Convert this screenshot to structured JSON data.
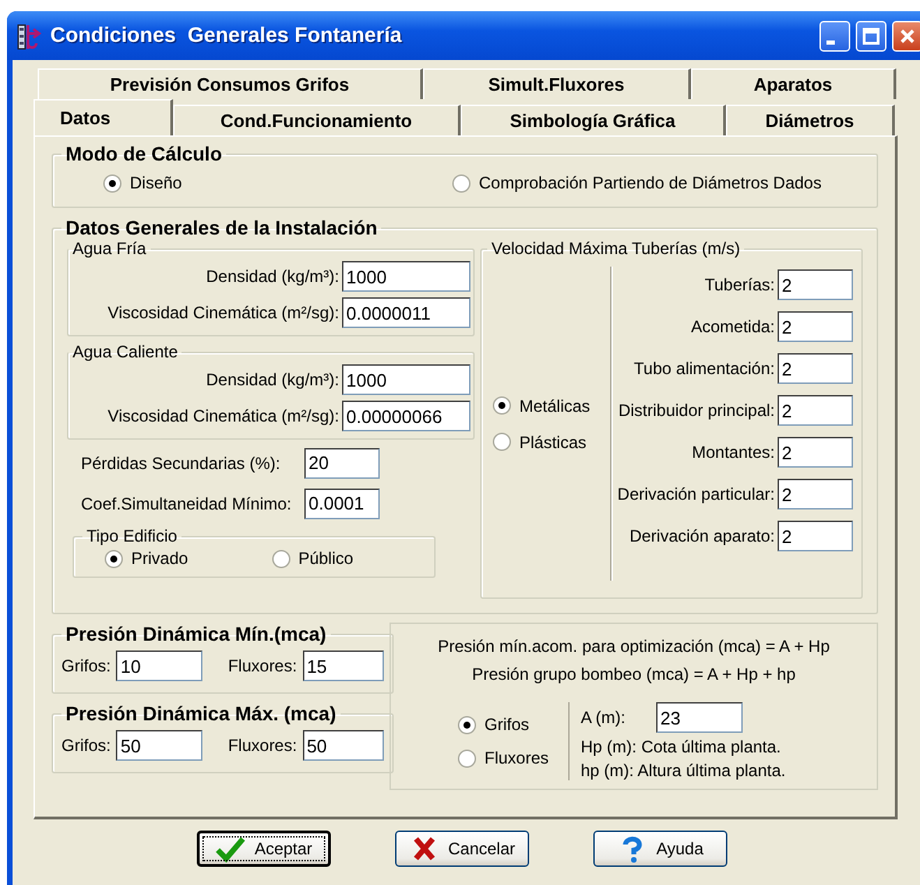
{
  "window": {
    "title": "Condiciones  Generales Fontanería"
  },
  "tab_rows": [
    {
      "tabs": [
        {
          "label": "Previsión Consumos Grifos",
          "selected": false
        },
        {
          "label": "Simult.Fluxores",
          "selected": false
        },
        {
          "label": "Aparatos",
          "selected": false
        }
      ]
    },
    {
      "tabs": [
        {
          "label": "Datos",
          "selected": true
        },
        {
          "label": "Cond.Funcionamiento",
          "selected": false
        },
        {
          "label": "Simbología Gráfica",
          "selected": false
        },
        {
          "label": "Diámetros",
          "selected": false
        }
      ]
    }
  ],
  "modo_calculo": {
    "title": "Modo de Cálculo",
    "options": [
      {
        "label": "Diseño",
        "selected": true
      },
      {
        "label": "Comprobación Partiendo de Diámetros Dados",
        "selected": false
      }
    ]
  },
  "datos_generales": {
    "title": "Datos Generales de la Instalación",
    "agua_fria": {
      "title": "Agua Fría",
      "fields": [
        {
          "label": "Densidad (kg/m³):",
          "value": "1000"
        },
        {
          "label": "Viscosidad Cinemática (m²/sg):",
          "value": "0.0000011"
        }
      ]
    },
    "agua_caliente": {
      "title": "Agua Caliente",
      "fields": [
        {
          "label": "Densidad (kg/m³):",
          "value": "1000"
        },
        {
          "label": "Viscosidad Cinemática (m²/sg):",
          "value": "0.00000066"
        }
      ]
    },
    "extra_fields": [
      {
        "label": "Pérdidas Secundarias (%):",
        "value": "20"
      },
      {
        "label": "Coef.Simultaneidad Mínimo:",
        "value": "0.0001"
      }
    ],
    "tipo_edificio": {
      "title": "Tipo Edificio",
      "options": [
        {
          "label": "Privado",
          "selected": true
        },
        {
          "label": "Público",
          "selected": false
        }
      ]
    },
    "velocidad": {
      "title": "Velocidad Máxima Tuberías (m/s)",
      "options": [
        {
          "label": "Metálicas",
          "selected": true
        },
        {
          "label": "Plásticas",
          "selected": false
        }
      ],
      "fields": [
        {
          "label": "Tuberías:",
          "value": "2"
        },
        {
          "label": "Acometida:",
          "value": "2"
        },
        {
          "label": "Tubo alimentación:",
          "value": "2"
        },
        {
          "label": "Distribuidor principal:",
          "value": "2"
        },
        {
          "label": "Montantes:",
          "value": "2"
        },
        {
          "label": "Derivación particular:",
          "value": "2"
        },
        {
          "label": "Derivación aparato:",
          "value": "2"
        }
      ]
    }
  },
  "presion_min": {
    "title": "Presión Dinámica Mín.(mca)",
    "fields": [
      {
        "label": "Grifos:",
        "value": "10"
      },
      {
        "label": "Fluxores:",
        "value": "15"
      }
    ]
  },
  "presion_max": {
    "title": "Presión Dinámica Máx. (mca)",
    "fields": [
      {
        "label": "Grifos:",
        "value": "50"
      },
      {
        "label": "Fluxores:",
        "value": "50"
      }
    ]
  },
  "optimizacion": {
    "formulas": [
      "Presión mín.acom. para optimización (mca) = A + Hp",
      "Presión grupo bombeo (mca) = A + Hp + hp"
    ],
    "options": [
      {
        "label": "Grifos",
        "selected": true
      },
      {
        "label": "Fluxores",
        "selected": false
      }
    ],
    "field": {
      "label": "A (m):",
      "value": "23"
    },
    "notes": [
      "Hp (m): Cota última planta.",
      "hp (m): Altura última planta."
    ]
  },
  "buttons": [
    {
      "label": "Aceptar",
      "kind": "accept",
      "focused": true
    },
    {
      "label": "Cancelar",
      "kind": "cancel",
      "focused": false
    },
    {
      "label": "Ayuda",
      "kind": "help",
      "focused": false
    }
  ]
}
